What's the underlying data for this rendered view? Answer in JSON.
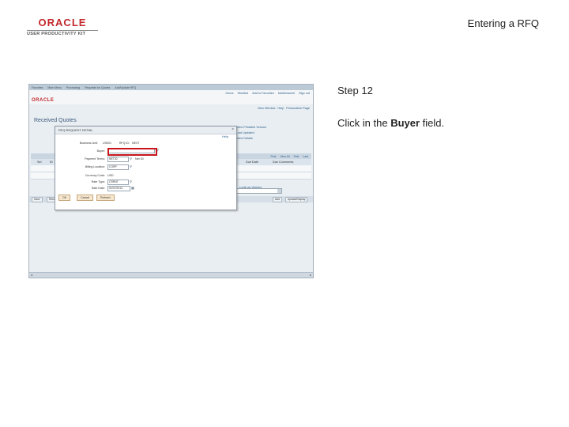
{
  "logo": {
    "word": "ORACLE",
    "subtitle": "USER PRODUCTIVITY KIT"
  },
  "doc_title": "Entering a RFQ",
  "step": {
    "title": "Step 12",
    "text_before": "Click in the ",
    "field": "Buyer",
    "text_after": " field."
  },
  "app": {
    "top_nav": [
      "Favorites",
      "Main Menu",
      "Purchasing",
      "Requests for Quotes",
      "Add/Update RFQ"
    ],
    "header_links": [
      "Home",
      "Worklist",
      "Add to Favorites",
      "Multichannel",
      "Sign out"
    ],
    "brand": "ORACLE",
    "page_links": [
      "New Window",
      "Help",
      "Personalize Page"
    ],
    "page_title": "Received Quotes",
    "right_panel": [
      "View Printable Version",
      "Last Updated",
      "View Details"
    ],
    "grid": {
      "toolbar": [
        "Find",
        "View All",
        "First",
        "Last"
      ],
      "headers": [
        "Sel",
        "ID",
        "Due Date",
        "Due Comments"
      ],
      "rows": 2
    },
    "lookup_label": "Look up Vendor",
    "bottom_buttons": [
      "Save",
      "Return to Search",
      "Add",
      "Update/Display"
    ],
    "dialog": {
      "title": "RFQ REQUEST DETAIL",
      "help": "Help",
      "business_unit_label": "Business Unit:",
      "business_unit_value": "US001",
      "rfq_id_label": "RFQ ID:",
      "rfq_id_value": "NEXT",
      "buyer_label": "Buyer:",
      "buyer_value": "",
      "payment_terms_label": "Payment Terms:",
      "payment_terms_value": "NET30",
      "payment_terms_desc": "Net 30",
      "billing_location_label": "Billing Location:",
      "billing_location_value": "CORP",
      "currency_label": "Currency Code:",
      "currency_value": "USD",
      "rate_type_label": "Rate Type:",
      "rate_type_value": "CRRNT",
      "rate_date_label": "Rate Date:",
      "rate_date_value": "02/07/2013",
      "buttons": [
        "OK",
        "Cancel",
        "Refresh"
      ]
    }
  },
  "colors": {
    "highlight": "#c8151d",
    "oracle_red": "#c2282c"
  },
  "icons": [
    "lookup-icon",
    "close-icon",
    "dropdown-arrow-icon",
    "scroll-left-icon",
    "scroll-right-icon"
  ]
}
